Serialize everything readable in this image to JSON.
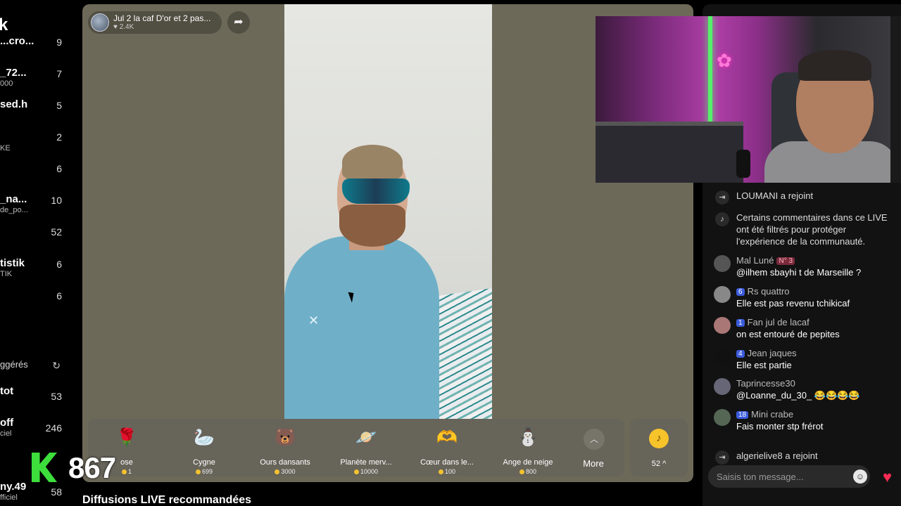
{
  "sidebar": {
    "brand": "k",
    "items": [
      {
        "name": "...cro...",
        "sub": "",
        "count": "9"
      },
      {
        "name": "_72...",
        "sub": "000",
        "count": "7"
      },
      {
        "name": "sed.h",
        "sub": "",
        "count": "5"
      },
      {
        "name": "",
        "sub": "KE",
        "count": "2"
      },
      {
        "name": "",
        "sub": "",
        "count": "6"
      },
      {
        "name": "_na...",
        "sub": "de_po...",
        "count": "10"
      },
      {
        "name": "",
        "sub": "",
        "count": "52"
      },
      {
        "name": "tistik",
        "sub": "TIK",
        "count": "6"
      },
      {
        "name": "",
        "sub": "",
        "count": "6"
      }
    ],
    "section_title": "ggérés",
    "suggested": [
      {
        "name": "tot",
        "sub": "",
        "count": "53"
      },
      {
        "name": "off",
        "sub": "ciel",
        "count": "246"
      },
      {
        "name": "",
        "sub": "",
        "count": ""
      },
      {
        "name": "ny.49",
        "sub": "fficiel",
        "count": "58"
      }
    ]
  },
  "host": {
    "title": "Jul 2 la caf D'or et 2 pas...",
    "likes": "2.4K"
  },
  "gifts": [
    {
      "name": "ose",
      "price": "1",
      "icon": "rose-icon",
      "glyph": "🌹"
    },
    {
      "name": "Cygne",
      "price": "699",
      "icon": "swan-icon",
      "glyph": "🦢"
    },
    {
      "name": "Ours dansants",
      "price": "3000",
      "icon": "dancing-bears-icon",
      "glyph": "🐻"
    },
    {
      "name": "Planète merv...",
      "price": "10000",
      "icon": "planet-icon",
      "glyph": "🪐"
    },
    {
      "name": "Cœur dans le...",
      "price": "100",
      "icon": "heart-hands-icon",
      "glyph": "🫶"
    },
    {
      "name": "Ange de neige",
      "price": "800",
      "icon": "snow-angel-icon",
      "glyph": "⛄"
    }
  ],
  "more_label": "More",
  "coins": "52",
  "recommended_title": "Diffusions LIVE recommandées",
  "overlay": {
    "number": "867"
  },
  "chat": {
    "header": "",
    "messages": [
      {
        "type": "system",
        "user": "LOUMANI",
        "text": "a rejoint"
      },
      {
        "type": "notice",
        "text": "Certains commentaires dans ce LIVE ont été filtrés pour protéger l'expérience de la communauté."
      },
      {
        "type": "msg",
        "user": "Mal Luné",
        "badge": "",
        "red_badge": "N° 3",
        "text": "@ilhem sbayhi t de Marseille ?",
        "avatar": "#555"
      },
      {
        "type": "msg",
        "user": "Rs quattro",
        "badge": "6",
        "red_badge": "",
        "text": "Elle est pas revenu tchikicaf",
        "avatar": "#888"
      },
      {
        "type": "msg",
        "user": "Fan jul de lacaf",
        "badge": "1",
        "red_badge": "",
        "text": "on est entouré de pepites",
        "avatar": "#a77"
      },
      {
        "type": "msg",
        "user": "Jean jaques",
        "badge": "4",
        "red_badge": "",
        "text": "Elle est partie",
        "avatar": "#111"
      },
      {
        "type": "msg",
        "user": "Taprincesse30",
        "badge": "",
        "red_badge": "",
        "text": "@Loanne_du_30_ 😂😂😂😂",
        "avatar": "#667"
      },
      {
        "type": "msg",
        "user": "Mini crabe",
        "badge": "18",
        "red_badge": "",
        "text": "Fais monter stp frérot",
        "avatar": "#565"
      },
      {
        "type": "system",
        "user": "algerielive8",
        "text": "a rejoint"
      }
    ],
    "input_placeholder": "Saisis ton message..."
  }
}
